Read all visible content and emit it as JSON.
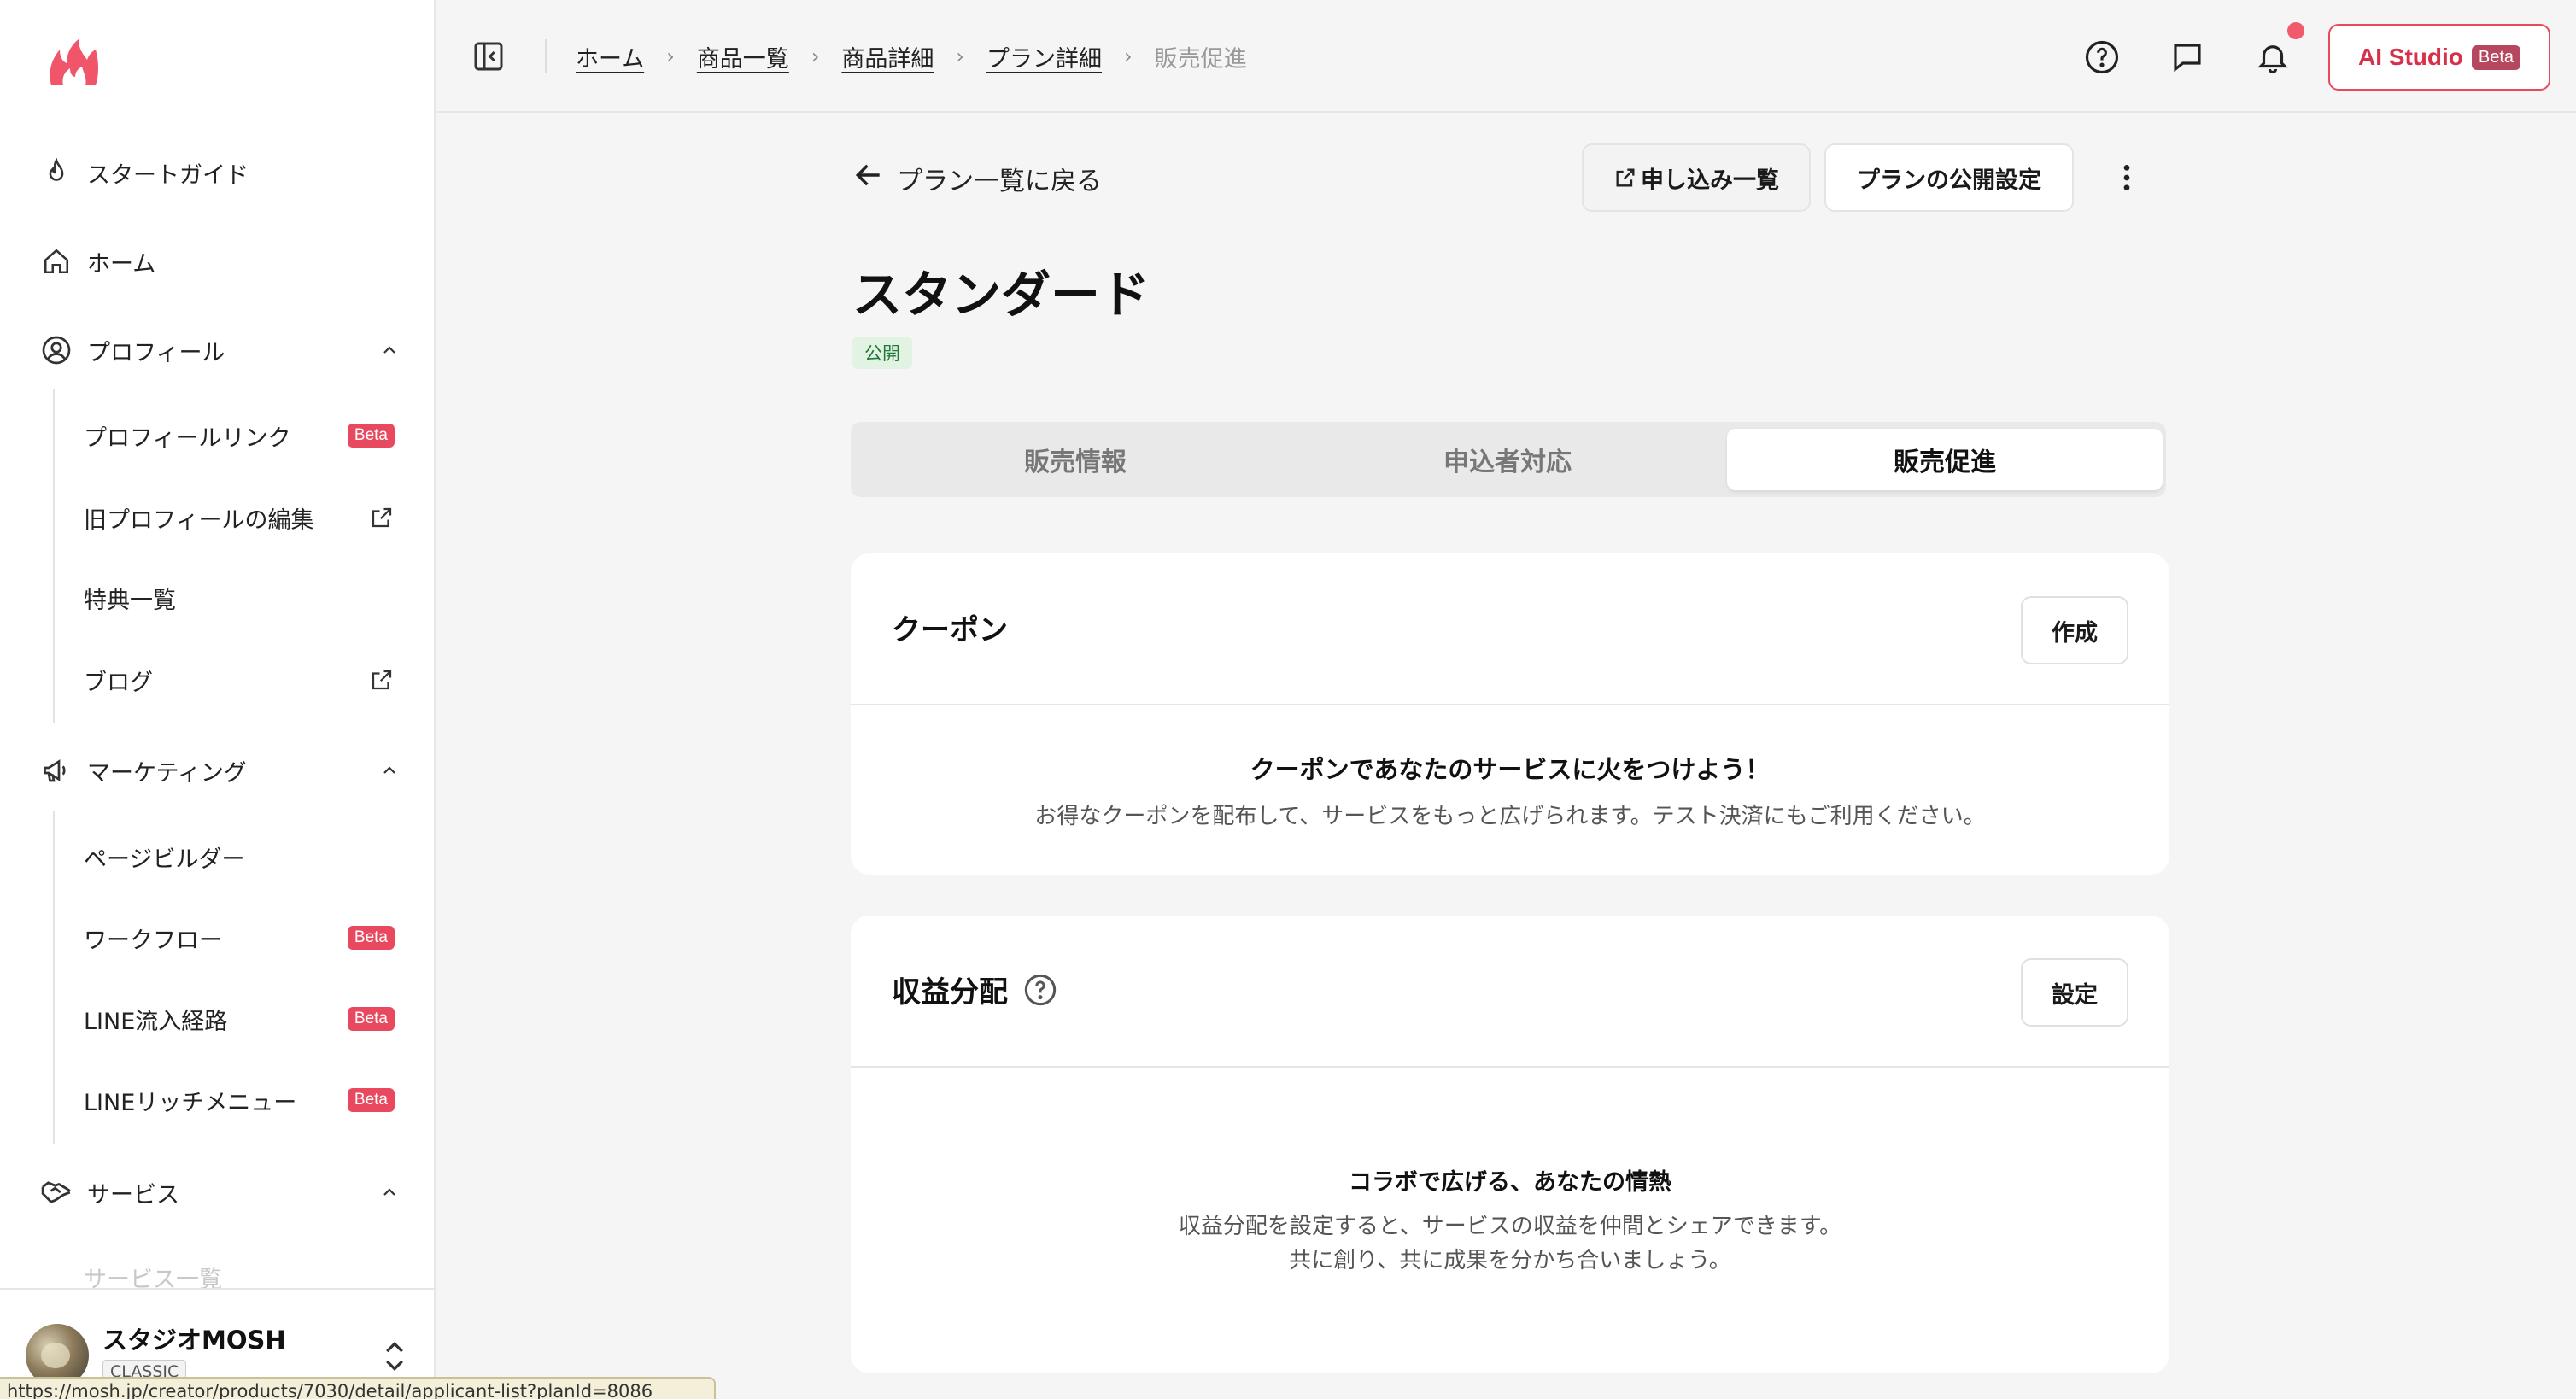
{
  "sidebar": {
    "items": [
      {
        "label": "スタートガイド",
        "icon": "flame-icon"
      },
      {
        "label": "ホーム",
        "icon": "home-icon"
      },
      {
        "label": "プロフィール",
        "icon": "user-circle-icon"
      },
      {
        "label": "マーケティング",
        "icon": "megaphone-icon"
      },
      {
        "label": "サービス",
        "icon": "handshake-icon"
      }
    ],
    "profile_sub": [
      {
        "label": "プロフィールリンク",
        "badge": "Beta"
      },
      {
        "label": "旧プロフィールの編集",
        "icon": "external-link-icon"
      },
      {
        "label": "特典一覧"
      },
      {
        "label": "ブログ",
        "icon": "external-link-icon"
      }
    ],
    "marketing_sub": [
      {
        "label": "ページビルダー"
      },
      {
        "label": "ワークフロー",
        "badge": "Beta"
      },
      {
        "label": "LINE流入経路",
        "badge": "Beta"
      },
      {
        "label": "LINEリッチメニュー",
        "badge": "Beta"
      }
    ],
    "service_sub_partial": "サービス一覧",
    "account": {
      "name": "スタジオMOSH",
      "tag": "CLASSIC"
    }
  },
  "status_url": "https://mosh.jp/creator/products/7030/detail/applicant-list?planId=8086",
  "breadcrumb": [
    "ホーム",
    "商品一覧",
    "商品詳細",
    "プラン詳細",
    "販売促進"
  ],
  "header": {
    "ai_studio": "AI Studio",
    "ai_badge": "Beta"
  },
  "page": {
    "back_label": "プラン一覧に戻る",
    "applications_button": "申し込み一覧",
    "publish_button": "プランの公開設定",
    "title": "スタンダード",
    "status": "公開",
    "tabs": [
      "販売情報",
      "申込者対応",
      "販売促進"
    ],
    "active_tab": "販売促進"
  },
  "coupon": {
    "title": "クーポン",
    "button": "作成",
    "empty_title": "クーポンであなたのサービスに火をつけよう！",
    "empty_desc": "お得なクーポンを配布して、サービスをもっと広げられます。テスト決済にもご利用ください。"
  },
  "revenue": {
    "title": "収益分配",
    "button": "設定",
    "empty_title": "コラボで広げる、あなたの情熱",
    "empty_desc_1": "収益分配を設定すると、サービスの収益を仲間とシェアできます。",
    "empty_desc_2": "共に創り、共に成果を分かち合いましょう。"
  },
  "colors": {
    "accent": "#e8495f",
    "status_green": "#1f7a35",
    "background": "#f5f5f5"
  }
}
